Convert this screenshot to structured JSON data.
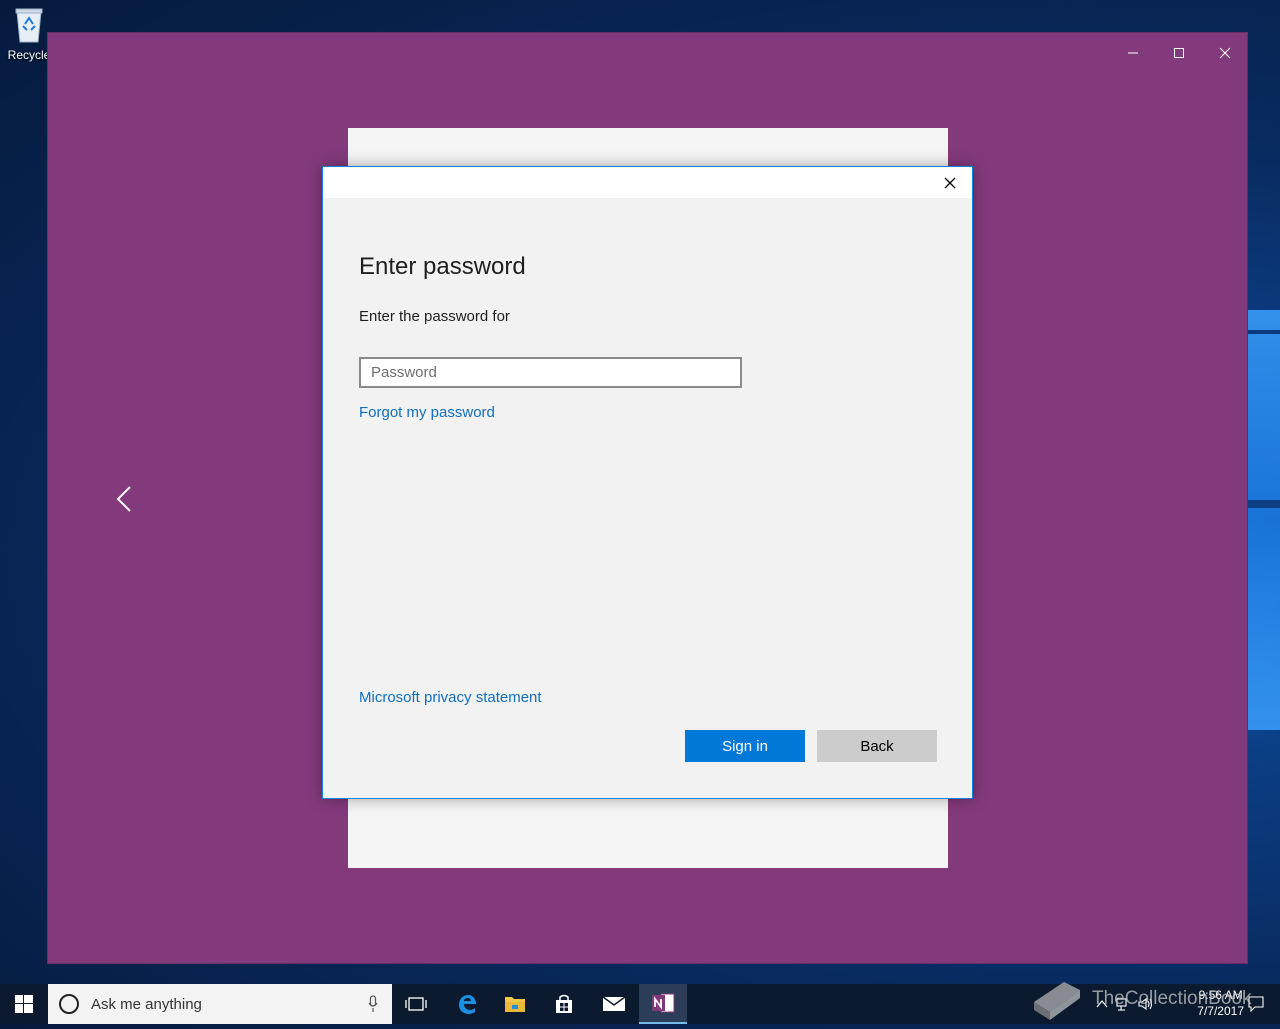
{
  "desktop": {
    "recycle_label": "Recycle"
  },
  "window": {
    "minimize_icon": "minimize-icon",
    "maximize_icon": "maximize-icon",
    "close_icon": "close-icon",
    "background_color": "#833a7c"
  },
  "dialog": {
    "title": "Enter password",
    "subtitle": "Enter the password for",
    "password_placeholder": "Password",
    "forgot_link": "Forgot my password",
    "privacy_link": "Microsoft privacy statement",
    "signin_label": "Sign in",
    "back_label": "Back",
    "accent_color": "#0078d7"
  },
  "taskbar": {
    "search_placeholder": "Ask me anything",
    "time": "9:56 AM",
    "date": "7/7/2017",
    "watermark": "TheCollectionBook"
  }
}
